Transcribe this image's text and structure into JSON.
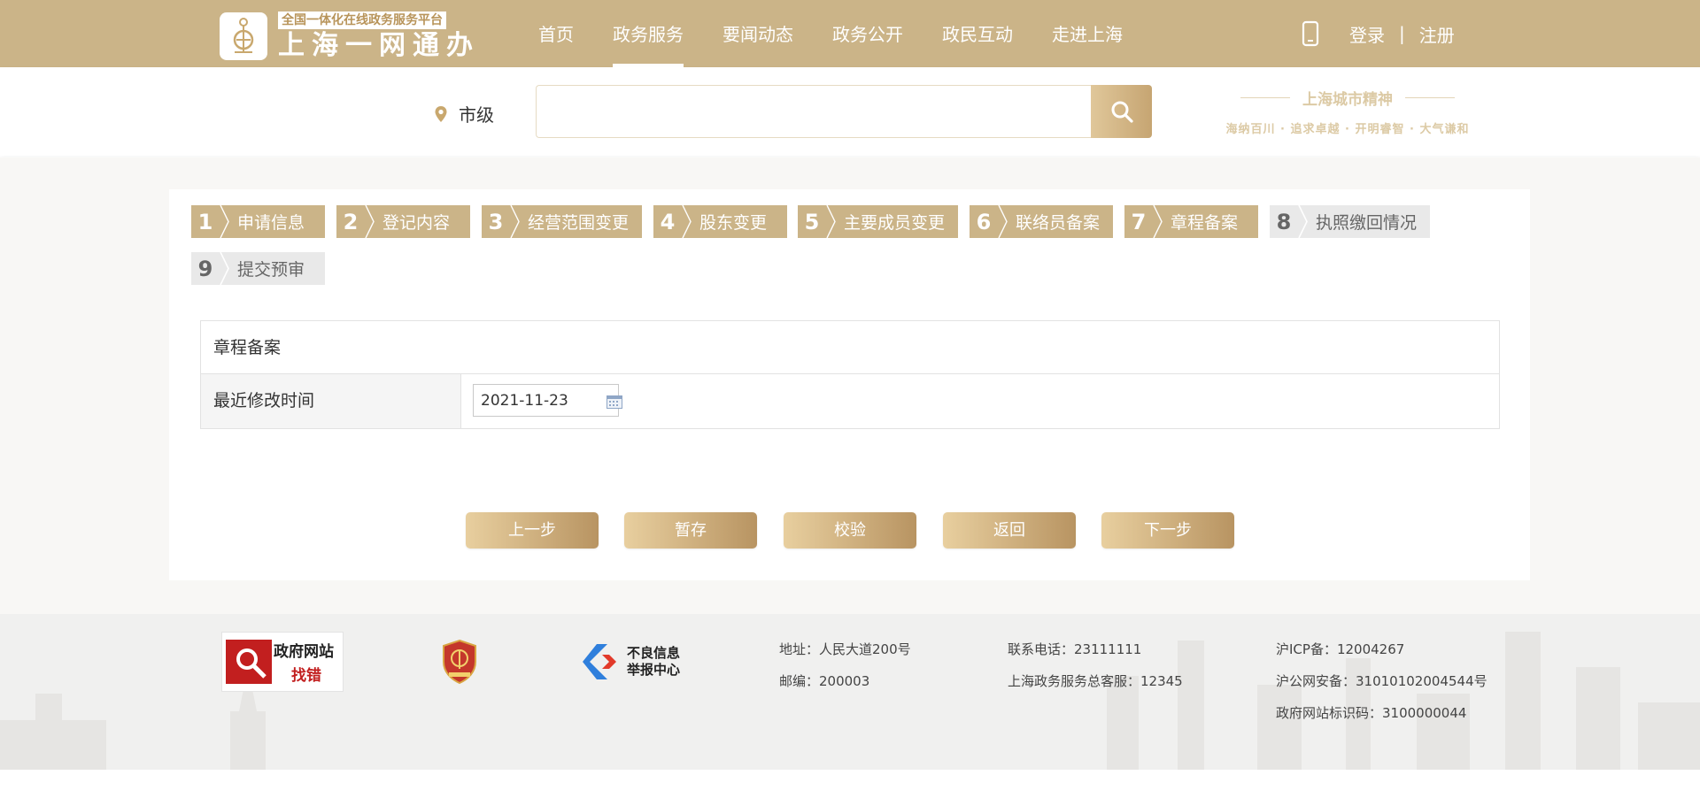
{
  "header": {
    "logo_tagline": "全国一体化在线政务服务平台",
    "logo_name": "上海一网通办",
    "nav": [
      {
        "label": "首页",
        "active": false
      },
      {
        "label": "政务服务",
        "active": true
      },
      {
        "label": "要闻动态",
        "active": false
      },
      {
        "label": "政务公开",
        "active": false
      },
      {
        "label": "政民互动",
        "active": false
      },
      {
        "label": "走进上海",
        "active": false
      }
    ],
    "phone_icon": "mobile-phone-icon",
    "login": "登录",
    "separator": "|",
    "register": "注册",
    "brand_color": "#cbb488"
  },
  "search": {
    "region": "市级",
    "pin_icon": "location-pin-icon",
    "placeholder": "",
    "value": "",
    "button_icon": "search-icon",
    "spirit_title": "上海城市精神",
    "spirit_motto": "海纳百川 · 追求卓越 · 开明睿智 · 大气谦和"
  },
  "steps": [
    {
      "num": "1",
      "label": "申请信息",
      "status": "done"
    },
    {
      "num": "2",
      "label": "登记内容",
      "status": "done"
    },
    {
      "num": "3",
      "label": "经营范围变更",
      "status": "done"
    },
    {
      "num": "4",
      "label": "股东变更",
      "status": "done"
    },
    {
      "num": "5",
      "label": "主要成员变更",
      "status": "done"
    },
    {
      "num": "6",
      "label": "联络员备案",
      "status": "done"
    },
    {
      "num": "7",
      "label": "章程备案",
      "status": "done"
    },
    {
      "num": "8",
      "label": "执照缴回情况",
      "status": "pending"
    },
    {
      "num": "9",
      "label": "提交预审",
      "status": "pending"
    }
  ],
  "form": {
    "section_title": "章程备案",
    "field_label": "最近修改时间",
    "field_value": "2021-11-23",
    "calendar_icon": "calendar-icon"
  },
  "actions": {
    "prev": "上一步",
    "save": "暂存",
    "validate": "校验",
    "back": "返回",
    "next": "下一步"
  },
  "footer": {
    "badge_find_line1": "政府网站",
    "badge_find_line2": "找错",
    "badge_shield_icon": "party-government-shield-icon",
    "badge_report_line1": "不良信息",
    "badge_report_line2": "举报中心",
    "address": "地址：人民大道200号",
    "postcode": "邮编：200003",
    "phone": "联系电话：23111111",
    "hotline": "上海政务服务总客服：12345",
    "icp": "沪ICP备：12004267",
    "police": "沪公网安备：31010102004544号",
    "site_id": "政府网站标识码：3100000044"
  }
}
